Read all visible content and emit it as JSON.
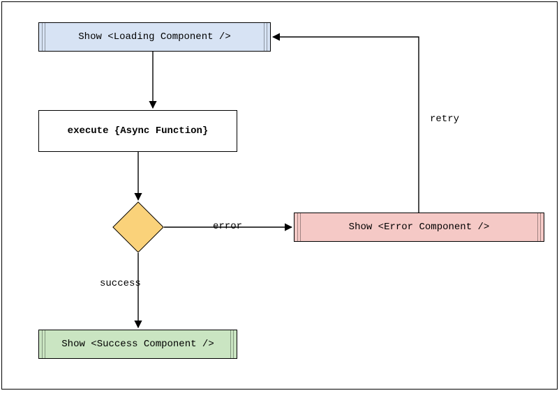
{
  "nodes": {
    "loading": {
      "label": "Show <Loading Component />",
      "color": "#d7e3f4"
    },
    "execute": {
      "label": "execute {Async Function}",
      "color": "#ffffff"
    },
    "decision": {
      "color": "#fad27a"
    },
    "error": {
      "label": "Show <Error Component />",
      "color": "#f5c9c6"
    },
    "success": {
      "label": "Show <Success Component />",
      "color": "#cae5c2"
    }
  },
  "edges": {
    "loading_to_execute": {
      "label": ""
    },
    "execute_to_decision": {
      "label": ""
    },
    "decision_to_error": {
      "label": "error"
    },
    "decision_to_success": {
      "label": "success"
    },
    "error_to_loading": {
      "label": "retry"
    }
  }
}
